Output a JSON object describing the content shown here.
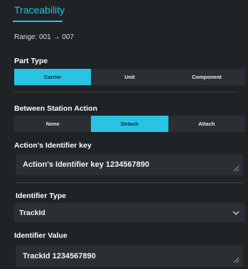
{
  "tabs": {
    "active_label": "Traceability"
  },
  "range_text": "Range: 001 → 007",
  "part_type": {
    "label": "Part Type",
    "options": [
      "Carrier",
      "Unit",
      "Component"
    ],
    "selected": "Carrier"
  },
  "between_station_action": {
    "label": "Between Station Action",
    "options": [
      "None",
      "Detach",
      "Attach"
    ],
    "selected": "Detach"
  },
  "action_identifier_key": {
    "label": "Action's Identifier key",
    "value": "Action's Identifier key 1234567890"
  },
  "identifier_type": {
    "label": "Identifier Type",
    "value": "TrackId"
  },
  "identifier_value": {
    "label": "Identifier Value",
    "value": "TrackId 1234567890"
  },
  "colors": {
    "accent": "#29c3e4",
    "background": "#1f2326",
    "field": "#2b2f33"
  },
  "icons": {
    "resize": "resize-grip-icon",
    "dropdown": "chevron-down-icon"
  }
}
